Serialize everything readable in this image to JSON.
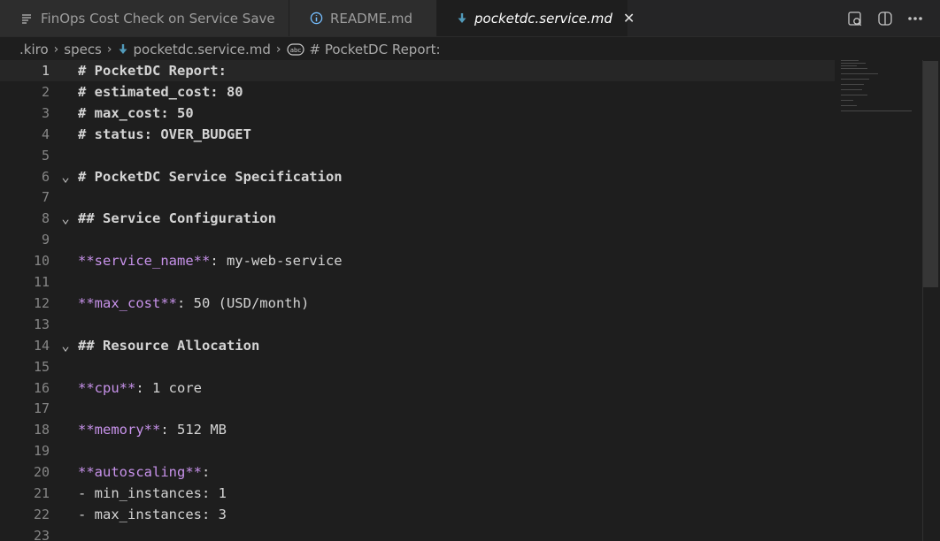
{
  "tabs": [
    {
      "label": "FinOps Cost Check on Service Save",
      "icon": "list-icon"
    },
    {
      "label": "README.md",
      "icon": "info-icon"
    },
    {
      "label": "pocketdc.service.md",
      "icon": "markdown-download-icon",
      "active": true,
      "close": "✕"
    }
  ],
  "tab_actions": [
    "preview-icon",
    "split-editor-icon",
    "more-actions-icon"
  ],
  "breadcrumb": {
    "items": [
      ".kiro",
      "specs",
      "pocketdc.service.md",
      "# PocketDC Report:"
    ]
  },
  "editor": {
    "lines": [
      {
        "n": "1",
        "text": "# PocketDC Report:"
      },
      {
        "n": "2",
        "text": "# estimated_cost: 80"
      },
      {
        "n": "3",
        "text": "# max_cost: 50"
      },
      {
        "n": "4",
        "text": "# status: OVER_BUDGET"
      },
      {
        "n": "5",
        "text": ""
      },
      {
        "n": "6",
        "text": "# PocketDC Service Specification",
        "fold": "⌄"
      },
      {
        "n": "7",
        "text": ""
      },
      {
        "n": "8",
        "text": "## Service Configuration",
        "fold": "⌄"
      },
      {
        "n": "9",
        "text": ""
      },
      {
        "n": "10",
        "key": "**service_name**",
        "value": ": my-web-service"
      },
      {
        "n": "11",
        "text": ""
      },
      {
        "n": "12",
        "key": "**max_cost**",
        "value": ": 50 (USD/month)"
      },
      {
        "n": "13",
        "text": ""
      },
      {
        "n": "14",
        "text": "## Resource Allocation",
        "fold": "⌄"
      },
      {
        "n": "15",
        "text": ""
      },
      {
        "n": "16",
        "key": "**cpu**",
        "value": ": 1 core"
      },
      {
        "n": "17",
        "text": ""
      },
      {
        "n": "18",
        "key": "**memory**",
        "value": ": 512 MB"
      },
      {
        "n": "19",
        "text": ""
      },
      {
        "n": "20",
        "key": "**autoscaling**",
        "value": ":"
      },
      {
        "n": "21",
        "text": "- min_instances: 1"
      },
      {
        "n": "22",
        "text": "- max_instances: 3"
      },
      {
        "n": "23",
        "text": ""
      }
    ]
  },
  "colors": {
    "bold_key": "#c792ea",
    "background": "#1e1e1e"
  }
}
